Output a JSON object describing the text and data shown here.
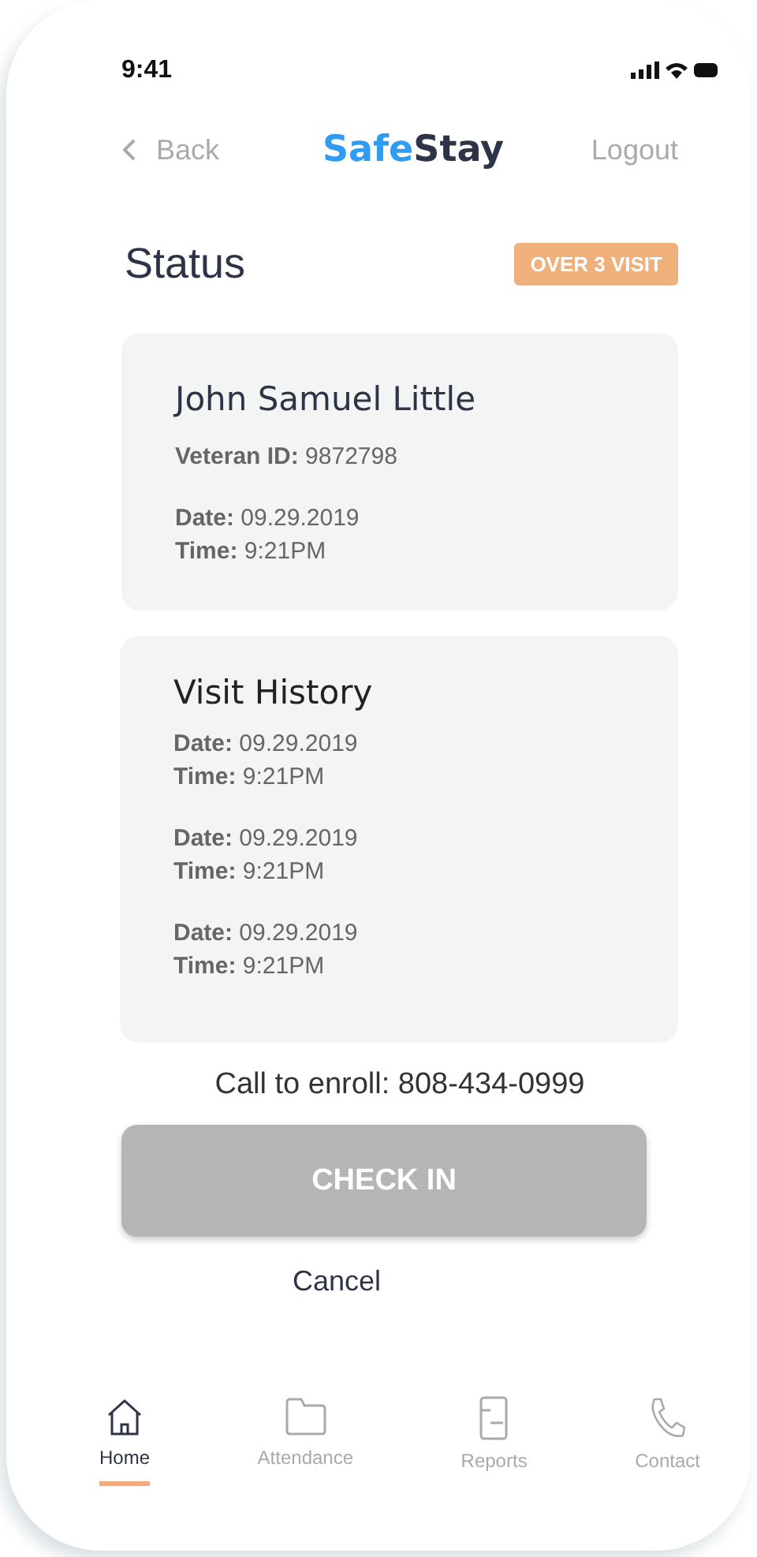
{
  "status_bar": {
    "time": "9:41"
  },
  "nav": {
    "back": "Back",
    "logo": {
      "first": "Safe",
      "second": "Stay"
    },
    "logout": "Logout"
  },
  "header": {
    "title": "Status",
    "badge": "OVER 3 VISIT"
  },
  "profile": {
    "name": "John Samuel Little",
    "veteran_id": "**Veteran ID:** 9872798",
    "date": "**Date:** 09.29.2019",
    "time": "**Time:** 9:21PM"
  },
  "history": {
    "title": "Visit History",
    "visits": [
      {
        "date": "**Date:** 09.29.2019",
        "time": "**Time:** 9:21PM"
      },
      {
        "date": "**Date:** 09.29.2019",
        "time": "**Time:** 9:21PM"
      },
      {
        "date": "**Date:** 09.29.2019",
        "time": "**Time:** 9:21PM"
      }
    ]
  },
  "enroll": "Call to enroll: 808-434-0999",
  "check_in": {
    "label": "CHECK IN",
    "disabled": true
  },
  "cancel": "Cancel",
  "tabs": [
    {
      "kind": "home",
      "label": "Home",
      "selected": true
    },
    {
      "kind": "folder",
      "label": "Attendance",
      "selected": false
    },
    {
      "kind": "document",
      "label": "Reports",
      "selected": false
    },
    {
      "kind": "phone",
      "label": "Contact",
      "selected": false
    }
  ]
}
